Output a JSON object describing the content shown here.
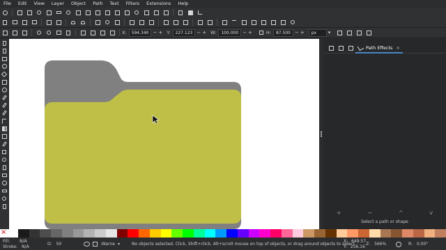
{
  "menu": [
    "File",
    "Edit",
    "View",
    "Layer",
    "Object",
    "Path",
    "Text",
    "Filters",
    "Extensions",
    "Help"
  ],
  "controls": {
    "x_label": "X:",
    "x_value": "594.340",
    "y_label": "Y:",
    "y_value": "227.123",
    "w_label": "W:",
    "w_value": "100.000",
    "h_label": "H:",
    "h_value": "87.500",
    "unit": "px"
  },
  "panel": {
    "active_tab": "Path Effects",
    "close_glyph": "×",
    "hint": "Select a path or shape",
    "add_glyph": "+",
    "remove_glyph": "−",
    "up_glyph": "^",
    "down_glyph": "v"
  },
  "status": {
    "fill_label": "Fill:",
    "fill_value": "N/A",
    "stroke_label": "Stroke:",
    "stroke_value": "N/A",
    "opacity_label": "O:",
    "opacity_value": "50",
    "layer": "-Warne",
    "message": "No objects selected. Click, Shift+click, Alt+scroll mouse on top of objects, or drag around objects to select.",
    "x_label": "X:",
    "x_value": "649.57",
    "y_label": "Y:",
    "y_value": "256.16",
    "zoom_label": "Z:",
    "zoom_value": "566%",
    "rotation_label": "R:",
    "rotation_value": "0.00°"
  },
  "colors": {
    "folder_back": "#808080",
    "folder_front": "#bfbf47",
    "accent": "#4f86c6"
  },
  "palette": [
    "#ffffff",
    "#1a1a1a",
    "#333333",
    "#4d4d4d",
    "#666666",
    "#808080",
    "#999999",
    "#b3b3b3",
    "#cccccc",
    "#e6e6e6",
    "#800000",
    "#ff0000",
    "#ff6600",
    "#ffcc00",
    "#ffff00",
    "#66ff00",
    "#00ff00",
    "#00ff99",
    "#00ffff",
    "#0099ff",
    "#0000ff",
    "#6600ff",
    "#cc00ff",
    "#ff00cc",
    "#ff0066",
    "#ff6699",
    "#ffccdd",
    "#cc9966",
    "#996633",
    "#663300",
    "#ffcc99",
    "#ff9966",
    "#cc6633",
    "#ffddaa",
    "#aa7755",
    "#885533",
    "#dd8866",
    "#bb6644",
    "#f0b080",
    "#c08060"
  ]
}
